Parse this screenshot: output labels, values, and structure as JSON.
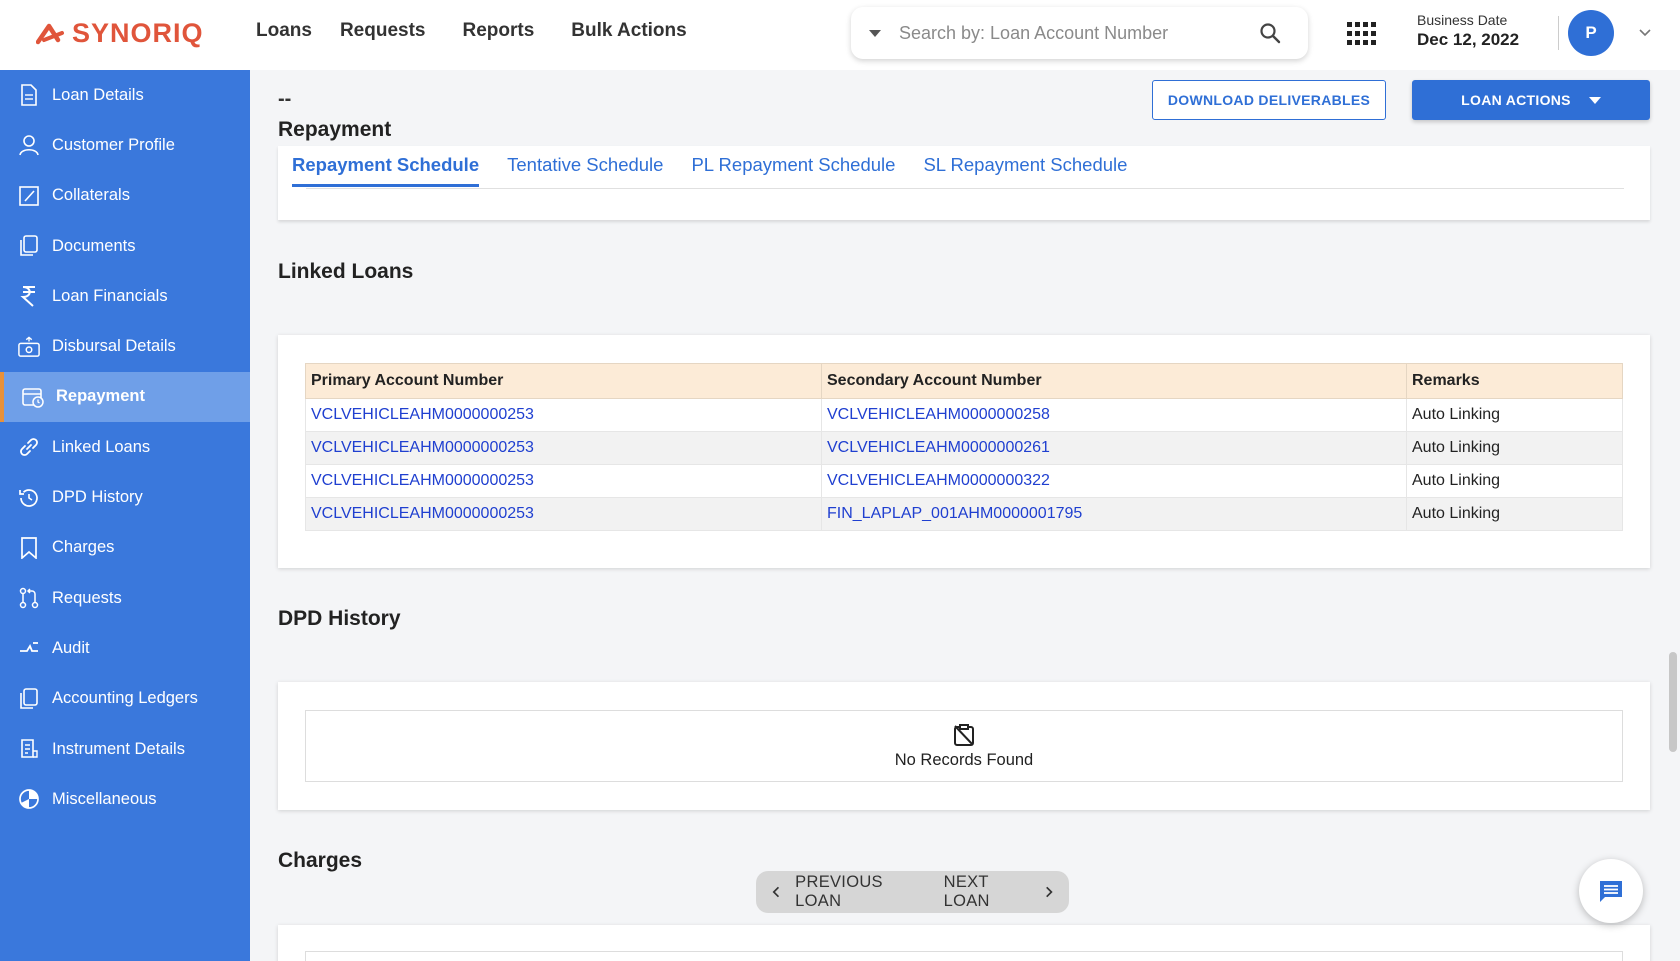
{
  "header": {
    "brand": "SYNORIQ",
    "nav": [
      "Loans",
      "Requests",
      "Reports",
      "Bulk Actions"
    ],
    "search_placeholder": "Search by: Loan Account Number",
    "business_date_label": "Business Date",
    "business_date_value": "Dec 12, 2022",
    "avatar_initial": "P"
  },
  "sidebar": {
    "items": [
      {
        "label": "Loan Details",
        "icon": "document-icon"
      },
      {
        "label": "Customer Profile",
        "icon": "person-icon"
      },
      {
        "label": "Collaterals",
        "icon": "edit-square-icon"
      },
      {
        "label": "Documents",
        "icon": "copy-icon"
      },
      {
        "label": "Loan Financials",
        "icon": "rupee-icon"
      },
      {
        "label": "Disbursal Details",
        "icon": "disbursal-icon"
      },
      {
        "label": "Repayment",
        "icon": "calendar-clock-icon"
      },
      {
        "label": "Linked Loans",
        "icon": "link-icon"
      },
      {
        "label": "DPD History",
        "icon": "history-icon"
      },
      {
        "label": "Charges",
        "icon": "bookmark-icon"
      },
      {
        "label": "Requests",
        "icon": "pull-request-icon"
      },
      {
        "label": "Audit",
        "icon": "audit-icon"
      },
      {
        "label": "Accounting Ledgers",
        "icon": "copy-icon"
      },
      {
        "label": "Instrument Details",
        "icon": "receipt-icon"
      },
      {
        "label": "Miscellaneous",
        "icon": "pie-icon"
      }
    ],
    "active_index": 6
  },
  "main": {
    "dash": "--",
    "download_label": "DOWNLOAD DELIVERABLES",
    "loan_actions_label": "LOAN ACTIONS",
    "repayment": {
      "title": "Repayment",
      "tabs": [
        "Repayment Schedule",
        "Tentative Schedule",
        "PL Repayment Schedule",
        "SL Repayment Schedule"
      ],
      "active_tab": 0
    },
    "linked_loans": {
      "title": "Linked Loans",
      "columns": [
        "Primary Account Number",
        "Secondary Account Number",
        "Remarks"
      ],
      "rows": [
        [
          "VCLVEHICLEAHM0000000253",
          "VCLVEHICLEAHM0000000258",
          "Auto Linking"
        ],
        [
          "VCLVEHICLEAHM0000000253",
          "VCLVEHICLEAHM0000000261",
          "Auto Linking"
        ],
        [
          "VCLVEHICLEAHM0000000253",
          "VCLVEHICLEAHM0000000322",
          "Auto Linking"
        ],
        [
          "VCLVEHICLEAHM0000000253",
          "FIN_LAPLAP_001AHM0000001795",
          "Auto Linking"
        ]
      ]
    },
    "dpd_history": {
      "title": "DPD History",
      "empty_text": "No Records Found"
    },
    "charges": {
      "title": "Charges"
    },
    "pager": {
      "prev_label": "PREVIOUS LOAN",
      "next_label": "NEXT LOAN"
    }
  },
  "colors": {
    "brand": "#e0553b",
    "sidebar_bg": "#3a78dc",
    "sidebar_active": "#6f9fe8",
    "accent": "#2f6fd6",
    "table_header_bg": "#fcebd7",
    "link": "#1f3fd0"
  }
}
